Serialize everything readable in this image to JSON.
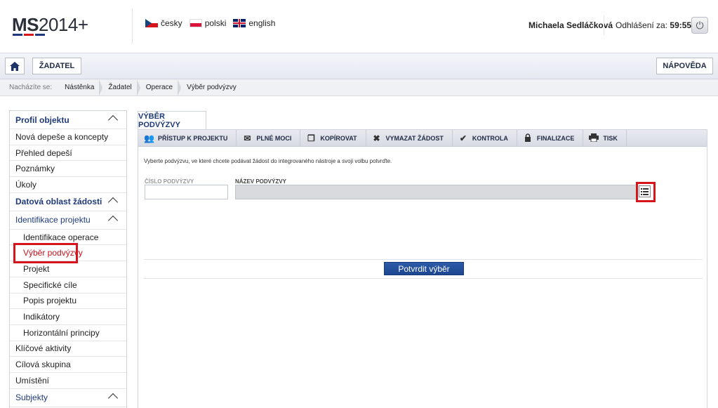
{
  "header": {
    "logo_ms": "MS",
    "logo_num": "2014+",
    "logo_bar_colors": [
      "#1f3a7a",
      "#d6141b",
      "#1f3a7a"
    ],
    "languages": [
      {
        "label": "česky",
        "flag": "cz-flag-icon"
      },
      {
        "label": "polski",
        "flag": "pl-flag-icon"
      },
      {
        "label": "english",
        "flag": "gb-flag-icon"
      }
    ],
    "user_name": "Michaela Sedláčková",
    "logout_label": "Odhlášení za:",
    "logout_time": "59:55",
    "power_icon": "power-icon"
  },
  "navbar": {
    "home_icon": "home-icon",
    "zadatel_label": "ŽADATEL",
    "help_label": "NÁPOVĚDA"
  },
  "breadcrumb": {
    "prefix": "Nacházíte se:",
    "items": [
      "Nástěnka",
      "Žadatel",
      "Operace",
      "Výběr podvýzvy"
    ]
  },
  "sidebar": {
    "items": [
      {
        "label": "Profil objektu",
        "type": "section"
      },
      {
        "label": "Nová depeše a koncepty",
        "type": "item"
      },
      {
        "label": "Přehled depeší",
        "type": "item"
      },
      {
        "label": "Poznámky",
        "type": "item"
      },
      {
        "label": "Úkoly",
        "type": "item"
      },
      {
        "label": "Datová oblast žádosti",
        "type": "section"
      },
      {
        "label": "Identifikace projektu",
        "type": "section2"
      },
      {
        "label": "Identifikace operace",
        "type": "sub"
      },
      {
        "label": "Výběr podvýzvy",
        "type": "sub-active"
      },
      {
        "label": "Projekt",
        "type": "sub"
      },
      {
        "label": "Specifické cíle",
        "type": "sub"
      },
      {
        "label": "Popis projektu",
        "type": "sub"
      },
      {
        "label": "Indikátory",
        "type": "sub"
      },
      {
        "label": "Horizontální principy",
        "type": "sub"
      },
      {
        "label": "Klíčové aktivity",
        "type": "item"
      },
      {
        "label": "Cílová skupina",
        "type": "item"
      },
      {
        "label": "Umístění",
        "type": "item"
      },
      {
        "label": "Subjekty",
        "type": "section2"
      }
    ]
  },
  "main": {
    "tab_title": "VÝBĚR PODVÝZVY",
    "toolbar": [
      {
        "label": "PŘÍSTUP K PROJEKTU",
        "icon": "users-icon"
      },
      {
        "label": "PLNÉ MOCI",
        "icon": "mail-icon"
      },
      {
        "label": "KOPÍROVAT",
        "icon": "copy-icon"
      },
      {
        "label": "VYMAZAT ŽÁDOST",
        "icon": "delete-icon"
      },
      {
        "label": "KONTROLA",
        "icon": "check-icon"
      },
      {
        "label": "FINALIZACE",
        "icon": "lock-icon"
      },
      {
        "label": "TISK",
        "icon": "print-icon"
      }
    ],
    "instruction": "Vyberte podvýzvu, ve které chcete podávat žádost do integrovaného nástroje a svoji volbu potvrďte.",
    "field_cislo_label": "ČÍSLO PODVÝZVY",
    "field_cislo_value": "",
    "field_nazev_label": "NÁZEV PODVÝZVY",
    "field_nazev_value": "",
    "list_icon": "list-icon",
    "confirm_label": "Potvrdit výběr"
  }
}
